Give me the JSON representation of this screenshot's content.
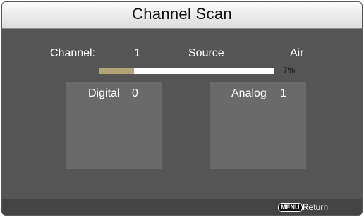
{
  "title": "Channel Scan",
  "scan": {
    "channel_label": "Channel:",
    "channel_value": "1",
    "source_label": "Source",
    "source_value": "Air",
    "progress_percent": 7,
    "progress_text": "7%"
  },
  "panels": {
    "digital": {
      "label": "Digital",
      "count": "0"
    },
    "analog": {
      "label": "Analog",
      "count": "1"
    }
  },
  "footer": {
    "menu_key": "MENU",
    "return_label": "Return"
  },
  "colors": {
    "progress_fill": "#b4a376",
    "background": "#555555",
    "panel": "#6a6a6a"
  }
}
